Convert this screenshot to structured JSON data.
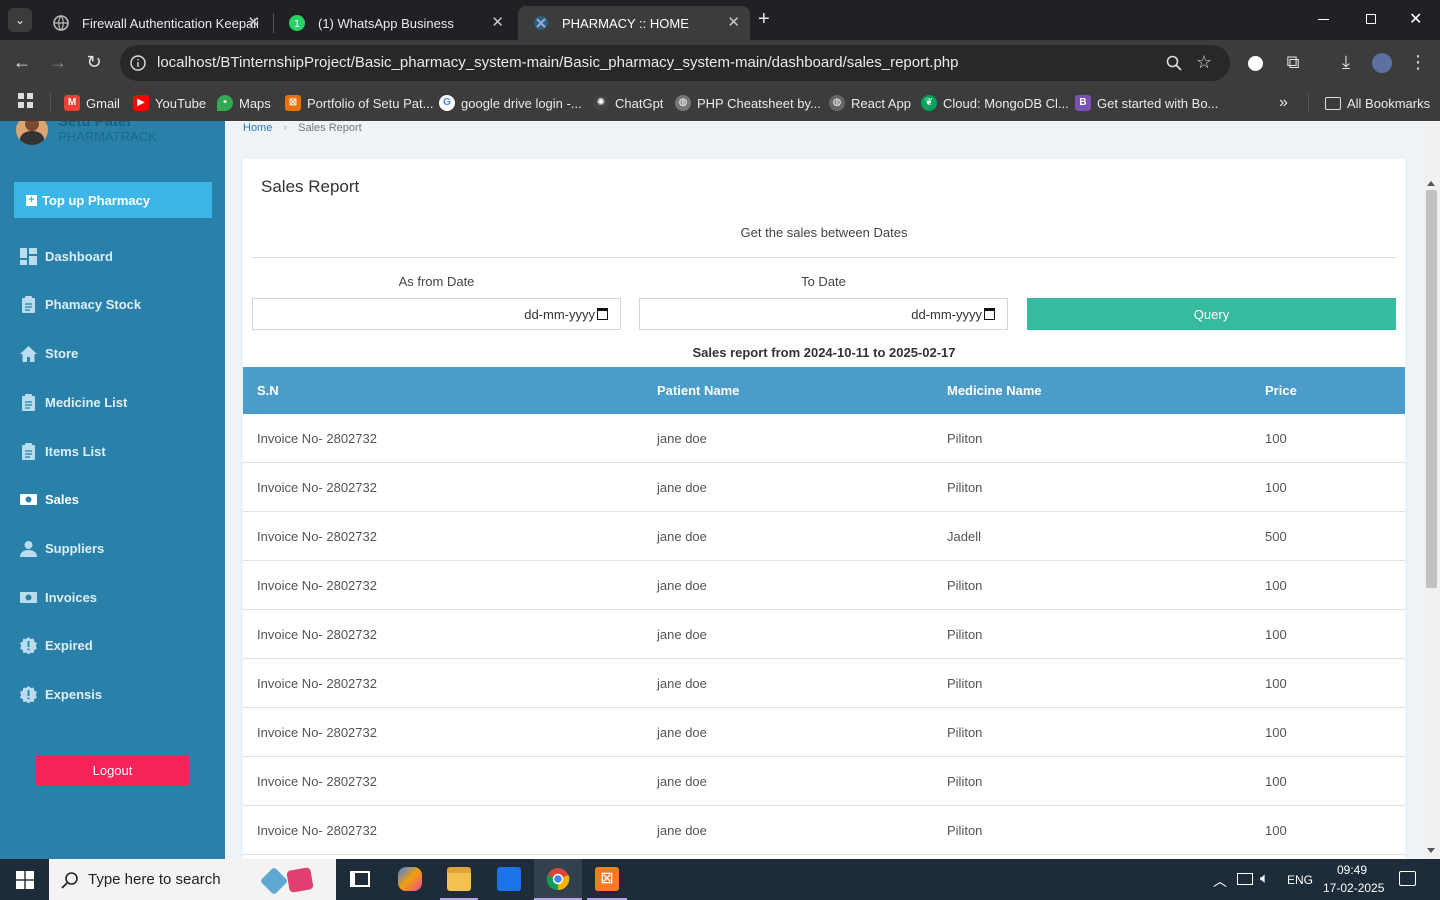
{
  "browser": {
    "tabs": [
      {
        "title": "Firewall Authentication Keepalive",
        "active": false
      },
      {
        "title": "(1) WhatsApp Business",
        "active": false
      },
      {
        "title": "PHARMACY :: HOME",
        "active": true
      }
    ],
    "url": "localhost/BTinternshipProject/Basic_pharmacy_system-main/Basic_pharmacy_system-main/dashboard/sales_report.php",
    "bookmarks": [
      {
        "label": "Gmail",
        "color": "#ea4335"
      },
      {
        "label": "YouTube",
        "color": "#ff0000"
      },
      {
        "label": "Maps",
        "color": "#34a853"
      },
      {
        "label": "Portfolio of Setu Pat...",
        "color": "#e8710a"
      },
      {
        "label": "google drive login -...",
        "color": "#4285f4"
      },
      {
        "label": "ChatGpt",
        "color": "#444444"
      },
      {
        "label": "PHP Cheatsheet by...",
        "color": "#777777"
      },
      {
        "label": "React App",
        "color": "#666666"
      },
      {
        "label": "Cloud: MongoDB Cl...",
        "color": "#00a35c"
      },
      {
        "label": "Get started with Bo...",
        "color": "#7952b3"
      }
    ],
    "all_bookmarks": "All Bookmarks"
  },
  "sidebar": {
    "user_name": "Setu Patel",
    "user_role": "PHARMATRACK",
    "top_up": "Top up Pharmacy",
    "items": [
      {
        "label": "Dashboard"
      },
      {
        "label": "Phamacy Stock"
      },
      {
        "label": "Store"
      },
      {
        "label": "Medicine List"
      },
      {
        "label": "Items List"
      },
      {
        "label": "Sales"
      },
      {
        "label": "Suppliers"
      },
      {
        "label": "Invoices"
      },
      {
        "label": "Expired"
      },
      {
        "label": "Expensis"
      }
    ],
    "logout": "Logout"
  },
  "breadcrumb": {
    "home": "Home",
    "current": "Sales Report"
  },
  "report": {
    "title": "Sales Report",
    "subtitle": "Get the sales between Dates",
    "from_label": "As from Date",
    "to_label": "To Date",
    "from_placeholder": "dd-mm-yyyy",
    "to_placeholder": "dd-mm-yyyy",
    "query_button": "Query",
    "range_text": "Sales report from 2024-10-11 to 2025-02-17",
    "columns": [
      "S.N",
      "Patient Name",
      "Medicine Name",
      "Price"
    ],
    "rows": [
      [
        "Invoice No- 2802732",
        "jane doe",
        "Piliton",
        "100"
      ],
      [
        "Invoice No- 2802732",
        "jane doe",
        "Piliton",
        "100"
      ],
      [
        "Invoice No- 2802732",
        "jane doe",
        "Jadell",
        "500"
      ],
      [
        "Invoice No- 2802732",
        "jane doe",
        "Piliton",
        "100"
      ],
      [
        "Invoice No- 2802732",
        "jane doe",
        "Piliton",
        "100"
      ],
      [
        "Invoice No- 2802732",
        "jane doe",
        "Piliton",
        "100"
      ],
      [
        "Invoice No- 2802732",
        "jane doe",
        "Piliton",
        "100"
      ],
      [
        "Invoice No- 2802732",
        "jane doe",
        "Piliton",
        "100"
      ],
      [
        "Invoice No- 2802732",
        "jane doe",
        "Piliton",
        "100"
      ]
    ]
  },
  "taskbar": {
    "search_placeholder": "Type here to search",
    "language": "ENG",
    "time": "09:49",
    "date": "17-02-2025"
  },
  "colors": {
    "sidebar": "#2980a8",
    "table_header": "#4b9cc8",
    "query": "#37bb9e",
    "logout": "#f4245a",
    "topup": "#3cb6e7"
  }
}
